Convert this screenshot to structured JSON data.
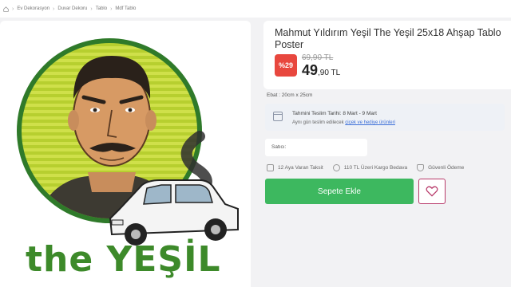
{
  "breadcrumb": {
    "items": [
      "Ev Dekorasyon",
      "Duvar Dekoru",
      "Tablo",
      "Mdf Tablo"
    ]
  },
  "product": {
    "title": "Mahmut Yıldırım Yeşil The Yeşil 25x18 Ahşap Tablo Poster",
    "discount_badge": "%29",
    "old_price": "69,90 TL",
    "price_main": "49",
    "price_decimal": ",90 TL",
    "size_label": "Ebat : 20cm x 25cm"
  },
  "delivery": {
    "line1": "Tahmini Teslim Tarihi: 8 Mart - 9 Mart",
    "line2_prefix": "Aynı gün teslim edilecek ",
    "line2_link": "çiçek ve hediye ürünleri"
  },
  "seller": {
    "label": "Satıcı:"
  },
  "features": [
    {
      "icon": "credit-card-icon",
      "label": "12 Aya Varan Taksit"
    },
    {
      "icon": "truck-icon",
      "label": "110 TL Üzeri Kargo Bedava"
    },
    {
      "icon": "shield-icon",
      "label": "Güvenli Ödeme"
    }
  ],
  "actions": {
    "add_to_cart": "Sepete Ekle"
  },
  "poster": {
    "caption": "the YEŞİL"
  },
  "colors": {
    "accent_green": "#3db85f",
    "badge_red": "#e8473e",
    "favorite_border": "#b83a6a",
    "poster_green": "#3d8a2a",
    "link_blue": "#3b6fd8"
  }
}
